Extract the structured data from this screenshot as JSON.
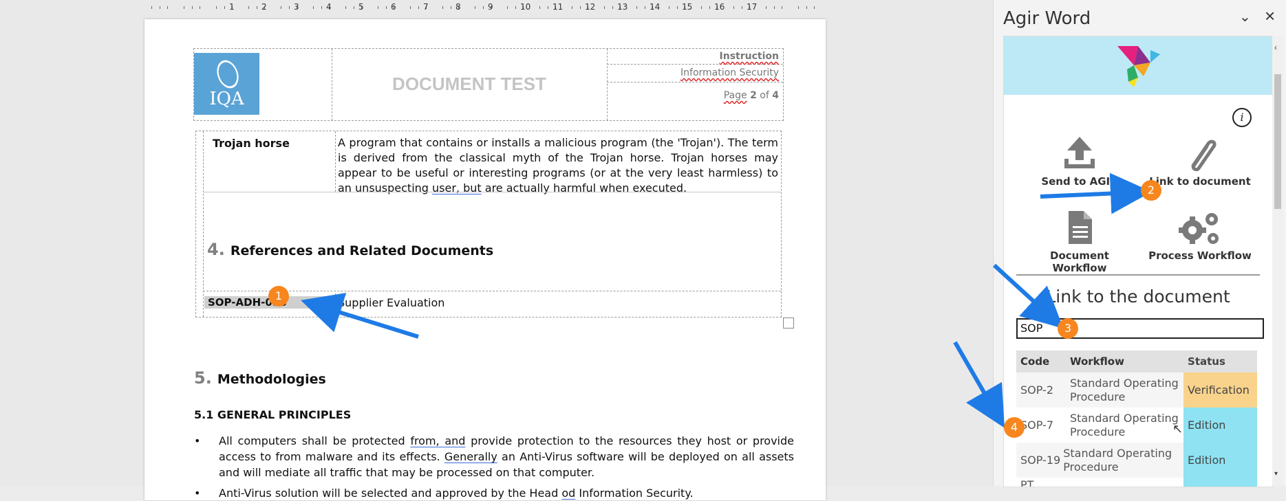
{
  "ruler": {
    "numbers": [
      "1",
      "2",
      "3",
      "4",
      "5",
      "6",
      "7",
      "8",
      "9",
      "10",
      "11",
      "12",
      "13",
      "14",
      "15",
      "16",
      "17"
    ]
  },
  "document": {
    "header": {
      "logo_text": "IQA",
      "title": "DOCUMENT TEST",
      "type": "Instruction",
      "department": "Information Security",
      "page_label": "Page",
      "page_num": "2",
      "page_of": "of",
      "page_total": "4"
    },
    "definition": {
      "term": "Trojan horse",
      "text_a": "A program that contains or installs a malicious program (the 'Trojan'). The term is derived from the classical myth of the Trojan horse. Trojan horses may appear to be useful or interesting programs (or at the very least harmless) to an unsuspecting ",
      "text_link": "user, but",
      "text_b": " are actually harmful when executed."
    },
    "section4": {
      "number": "4.",
      "title": "References and Related Documents"
    },
    "reference": {
      "code": "SOP-ADH-098",
      "title": "Supplier Evaluation"
    },
    "section5": {
      "number": "5.",
      "title": "Methodologies"
    },
    "subsection": "5.1 GENERAL PRINCIPLES",
    "bullets": {
      "b1_a": "All computers shall be protected ",
      "b1_link1": "from, and",
      "b1_b": " provide protection to the resources they host or provide access to from malware and its effects. ",
      "b1_link2": "Generally",
      "b1_c": " an Anti-Virus software will be deployed on all assets and will mediate all traffic that may be processed on that computer.",
      "b2_a": "Anti-Virus solution will be selected and approved by the Head ",
      "b2_link": "od",
      "b2_b": " Information Security."
    }
  },
  "pane": {
    "title": "Agir Word",
    "info": "i",
    "tiles": {
      "send": "Send to AGIR",
      "link": "Link to document",
      "docwf": "Document Workflow",
      "procwf": "Process Workflow"
    },
    "link_heading": "Link to the document",
    "search_value": "SOP",
    "table": {
      "headers": [
        "Code",
        "Workflow",
        "Status"
      ],
      "rows": [
        {
          "code": "SOP-2",
          "workflow": "Standard Operating Procedure",
          "status": "Verification"
        },
        {
          "code": "SOP-7",
          "workflow": "Standard Operating Procedure",
          "status": "Edition"
        },
        {
          "code": "SOP-19",
          "workflow": "Standard Operating Procedure",
          "status": "Edition"
        }
      ],
      "partial_row_code": "PT"
    },
    "colors": {
      "verification": "#f9d38c",
      "edition": "#8ee2f2",
      "banner": "#bde9f6"
    }
  },
  "callouts": [
    "1",
    "2",
    "3",
    "4"
  ]
}
